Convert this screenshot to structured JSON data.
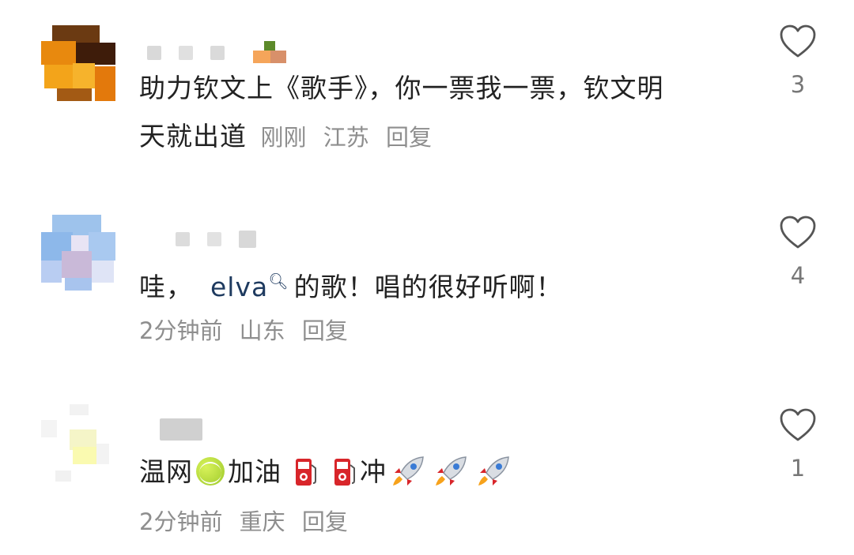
{
  "comments": [
    {
      "text_line1": "助力钦文上《歌手》，你一票我一票，钦文明",
      "text_line2": "天就出道",
      "time": "刚刚",
      "location": "江苏",
      "reply_label": "回复",
      "likes": "3"
    },
    {
      "text_prefix": "哇，",
      "mention": "elva",
      "text_suffix": "的歌！唱的很好听啊！",
      "time": "2分钟前",
      "location": "山东",
      "reply_label": "回复",
      "likes": "4"
    },
    {
      "text_part1": "温网",
      "text_part2": "加油",
      "text_part3": "冲",
      "time": "2分钟前",
      "location": "重庆",
      "reply_label": "回复",
      "likes": "1"
    }
  ],
  "icons": {
    "like": "heart-outline-icon",
    "tennis": "tennis-ball-emoji",
    "fuel": "fuel-pump-emoji",
    "rocket": "rocket-emoji",
    "search": "search-icon"
  },
  "colors": {
    "text": "#222222",
    "meta": "#8e8e8e",
    "mention": "#1e3a5f"
  }
}
